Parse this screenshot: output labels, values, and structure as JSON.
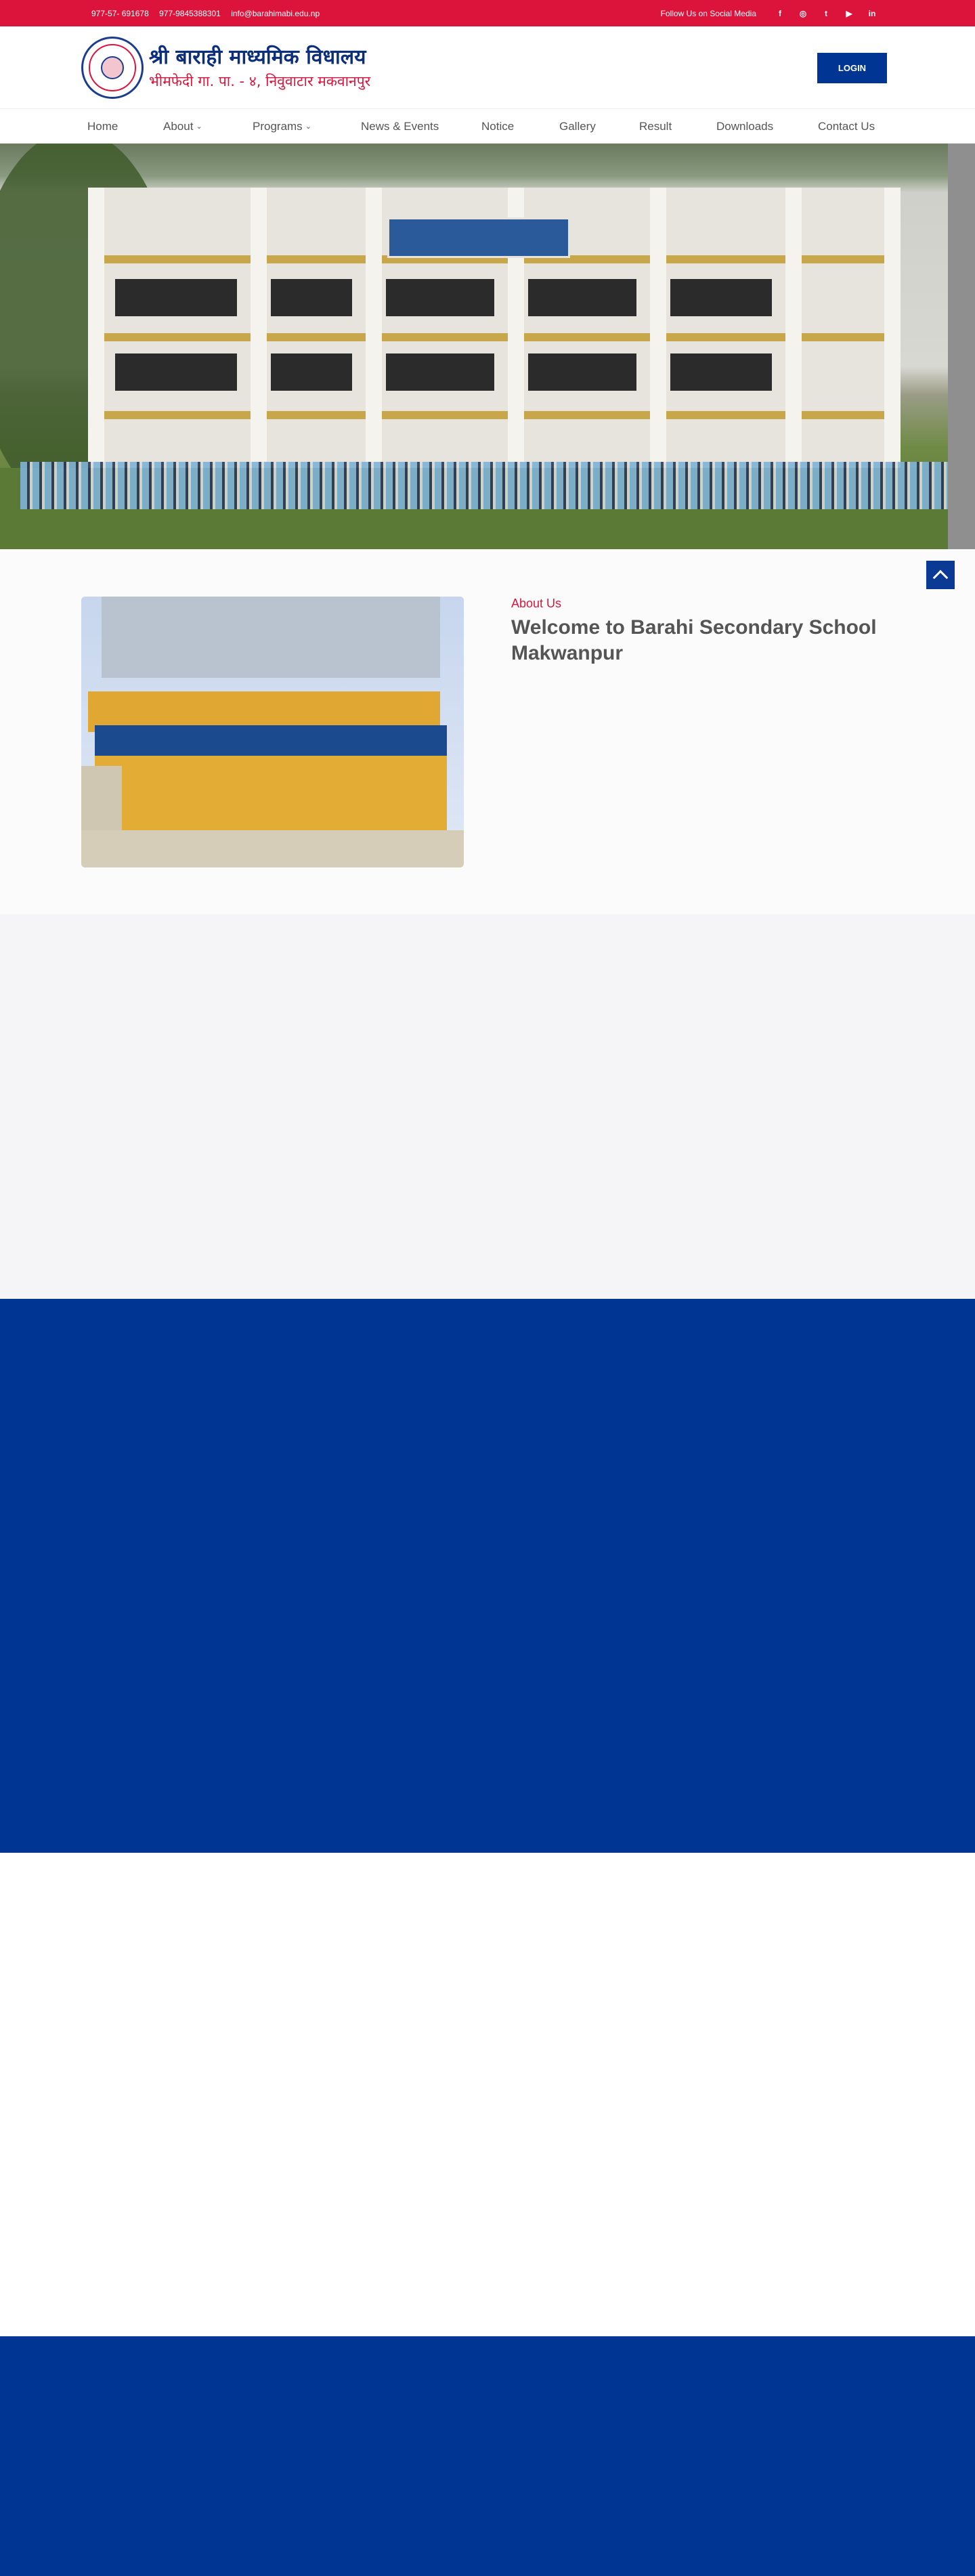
{
  "topbar": {
    "phone1": "977-57- 691678",
    "phone2": "977-9845388301",
    "email": "info@barahimabi.edu.np",
    "follow": "Follow Us on Social Media",
    "social": [
      "f",
      "◎",
      "t",
      "▶",
      "in"
    ]
  },
  "header": {
    "title": "श्री बाराही माध्यमिक विधालय",
    "subtitle": "भीमफेदी गा. पा. - ४, निवुवाटार मकवानपुर",
    "login": "LOGIN"
  },
  "nav": {
    "items": [
      "Home",
      "About",
      "Programs",
      "News & Events",
      "Notice",
      "Gallery",
      "Result",
      "Downloads",
      "Contact Us"
    ]
  },
  "about": {
    "eyebrow": "About Us",
    "heading": "Welcome to Barahi Secondary School Makwanpur"
  },
  "colors": {
    "accent_red": "#dc143c",
    "brand_blue": "#003594"
  }
}
